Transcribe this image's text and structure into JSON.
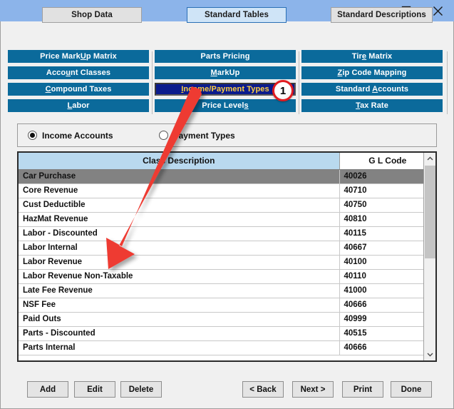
{
  "window": {
    "titlebar_color": "#8cb4ea",
    "controls": [
      {
        "name": "minimize",
        "glyph": "minimize-icon"
      },
      {
        "name": "maximize",
        "glyph": "maximize-icon"
      },
      {
        "name": "close",
        "glyph": "close-icon"
      }
    ]
  },
  "tabs": [
    {
      "label": "Shop Data",
      "active": false
    },
    {
      "label": "Standard Tables",
      "active": true
    },
    {
      "label": "Standard Descriptions",
      "active": false
    }
  ],
  "nav_columns": [
    {
      "buttons": [
        {
          "pre": "Price Mark",
          "accel": "U",
          "post": "p Matrix",
          "label": "Price MarkUp Matrix",
          "selected": false
        },
        {
          "pre": "Acco",
          "accel": "u",
          "post": "nt Classes",
          "label": "Account Classes",
          "selected": false
        },
        {
          "pre": "",
          "accel": "C",
          "post": "ompound Taxes",
          "label": "Compound Taxes",
          "selected": false
        },
        {
          "pre": "",
          "accel": "L",
          "post": "abor",
          "label": "Labor",
          "selected": false
        }
      ]
    },
    {
      "buttons": [
        {
          "pre": "Parts Pricin",
          "accel": "g",
          "post": "",
          "label": "Parts Pricing",
          "selected": false
        },
        {
          "pre": "",
          "accel": "M",
          "post": "arkUp",
          "label": "MarkUp",
          "selected": false
        },
        {
          "pre": "",
          "accel": "I",
          "post": "ncome/Payment Types",
          "label": "Income/Payment Types",
          "selected": true
        },
        {
          "pre": "Price Level",
          "accel": "s",
          "post": "",
          "label": "Price Levels",
          "selected": false
        }
      ]
    },
    {
      "buttons": [
        {
          "pre": "Tir",
          "accel": "e",
          "post": " Matrix",
          "label": "Tire Matrix",
          "selected": false
        },
        {
          "pre": "",
          "accel": "Z",
          "post": "ip Code Mapping",
          "label": "Zip Code Mapping",
          "selected": false
        },
        {
          "pre": "Standard ",
          "accel": "A",
          "post": "ccounts",
          "label": "Standard Accounts",
          "selected": false
        },
        {
          "pre": "",
          "accel": "T",
          "post": "ax Rate",
          "label": "Tax Rate",
          "selected": false
        }
      ]
    }
  ],
  "radio_group": {
    "options": [
      {
        "label": "Income Accounts",
        "selected": true
      },
      {
        "label": "Payment Types",
        "selected": false
      }
    ]
  },
  "table": {
    "columns": [
      "Class Description",
      "G L Code"
    ],
    "selected_row_index": 0,
    "rows": [
      {
        "description": "Car Purchase",
        "gl_code": "40026"
      },
      {
        "description": "Core Revenue",
        "gl_code": "40710"
      },
      {
        "description": "Cust Deductible",
        "gl_code": "40750"
      },
      {
        "description": "HazMat Revenue",
        "gl_code": "40810"
      },
      {
        "description": "Labor - Discounted",
        "gl_code": "40115"
      },
      {
        "description": "Labor Internal",
        "gl_code": "40667"
      },
      {
        "description": "Labor Revenue",
        "gl_code": "40100"
      },
      {
        "description": "Labor Revenue Non-Taxable",
        "gl_code": "40110"
      },
      {
        "description": "Late Fee Revenue",
        "gl_code": "41000"
      },
      {
        "description": "NSF Fee",
        "gl_code": "40666"
      },
      {
        "description": "Paid Outs",
        "gl_code": "40999"
      },
      {
        "description": "Parts - Discounted",
        "gl_code": "40515"
      },
      {
        "description": "Parts Internal",
        "gl_code": "40666"
      }
    ]
  },
  "action_buttons": {
    "left": [
      {
        "label": "Add"
      },
      {
        "label": "Edit"
      },
      {
        "label": "Delete"
      }
    ],
    "right": [
      {
        "label": "< Back"
      },
      {
        "label": "Next >"
      },
      {
        "label": "Print"
      },
      {
        "label": "Done"
      }
    ]
  },
  "annotation": {
    "badge_number": "1",
    "arrow_color": "#ee3b33",
    "badge_ring_color": "#e01b20"
  }
}
